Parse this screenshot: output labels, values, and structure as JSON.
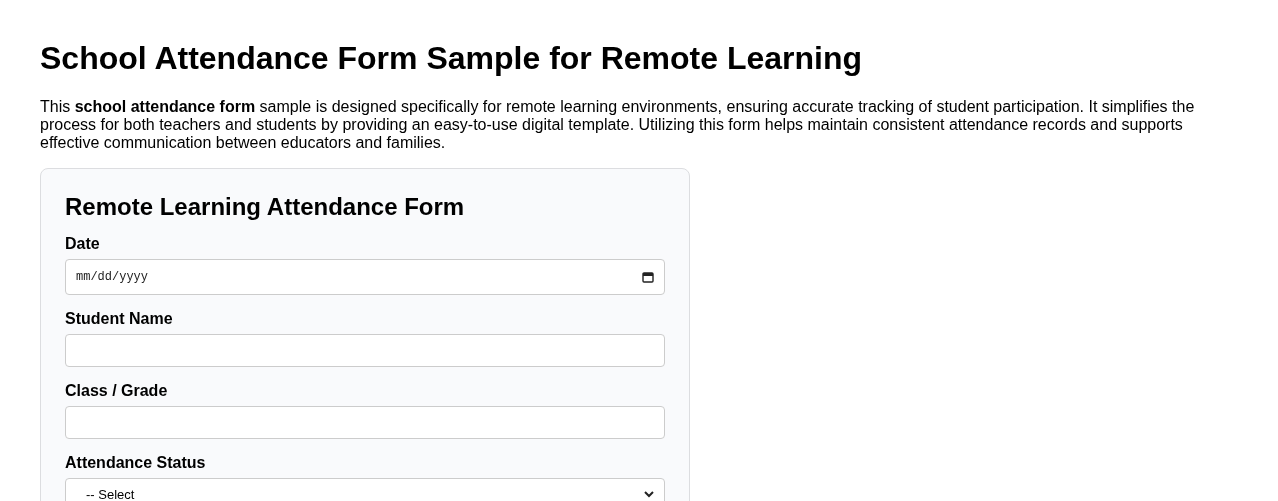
{
  "title": "School Attendance Form Sample for Remote Learning",
  "intro": "This **school attendance form** sample is designed specifically for remote learning environments, ensuring accurate tracking of student participation. It simplifies the process for both teachers and students by providing an easy-to-use digital template. Utilizing this form helps maintain consistent attendance records and supports effective communication between educators and families.",
  "form": {
    "title": "Remote Learning Attendance Form",
    "fields": [
      {
        "kind": "date",
        "label": "Date",
        "placeholder": "mm/dd/yyyy"
      },
      {
        "kind": "text",
        "label": "Student Name"
      },
      {
        "kind": "text",
        "label": "Class / Grade"
      },
      {
        "kind": "select",
        "label": "Attendance Status",
        "value": "-- Select"
      }
    ]
  }
}
